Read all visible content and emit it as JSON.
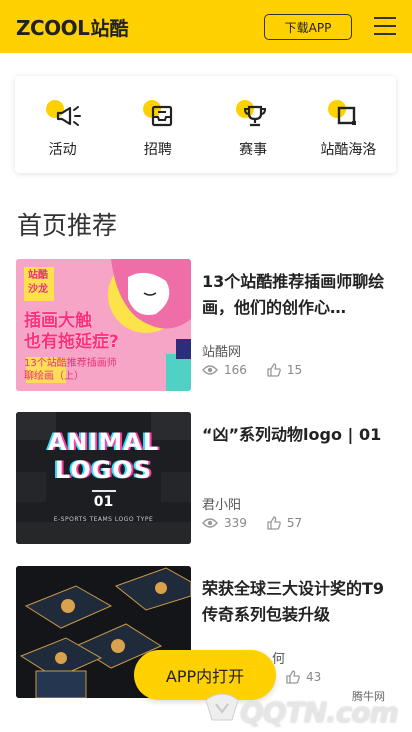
{
  "header": {
    "logo_en": "ZCOOL",
    "logo_cn": "站酷",
    "download_label": "下载APP"
  },
  "nav": [
    {
      "label": "活动",
      "icon": "megaphone-icon"
    },
    {
      "label": "招聘",
      "icon": "inbox-icon"
    },
    {
      "label": "赛事",
      "icon": "trophy-icon"
    },
    {
      "label": "站酷海洛",
      "icon": "square-icon"
    }
  ],
  "section_title": "首页推荐",
  "articles": [
    {
      "title": "13个站酷推荐插画师聊绘画，他们的创作心…",
      "author": "站酷网",
      "views": "166",
      "likes": "15",
      "thumb": {
        "badge_line1": "站酷",
        "badge_line2": "沙龙",
        "headline_line1": "插画大触",
        "headline_line2": "也有拖延症?",
        "sub_line1": "13个站酷推荐插画师",
        "sub_line2": "聊绘画（上）"
      }
    },
    {
      "title": "“凶”系列动物logo | 01",
      "author": "君小阳",
      "views": "339",
      "likes": "57",
      "thumb": {
        "headline_line1": "ANIMAL",
        "headline_line2": "LOGOS",
        "number": "01",
        "caption": "E-SPORTS TEAMS LOGO TYPE"
      }
    },
    {
      "title": "荣获全球三大设计奖的T9传奇系列包装升级",
      "author": "何",
      "views": "",
      "likes": "43",
      "thumb": {}
    }
  ],
  "open_app_label": "APP内打开",
  "watermark": {
    "site": "腾牛网",
    "text": "QQTN.com"
  },
  "colors": {
    "brand_yellow": "#ffd100",
    "text_dark": "#222222",
    "text_muted": "#888888"
  }
}
